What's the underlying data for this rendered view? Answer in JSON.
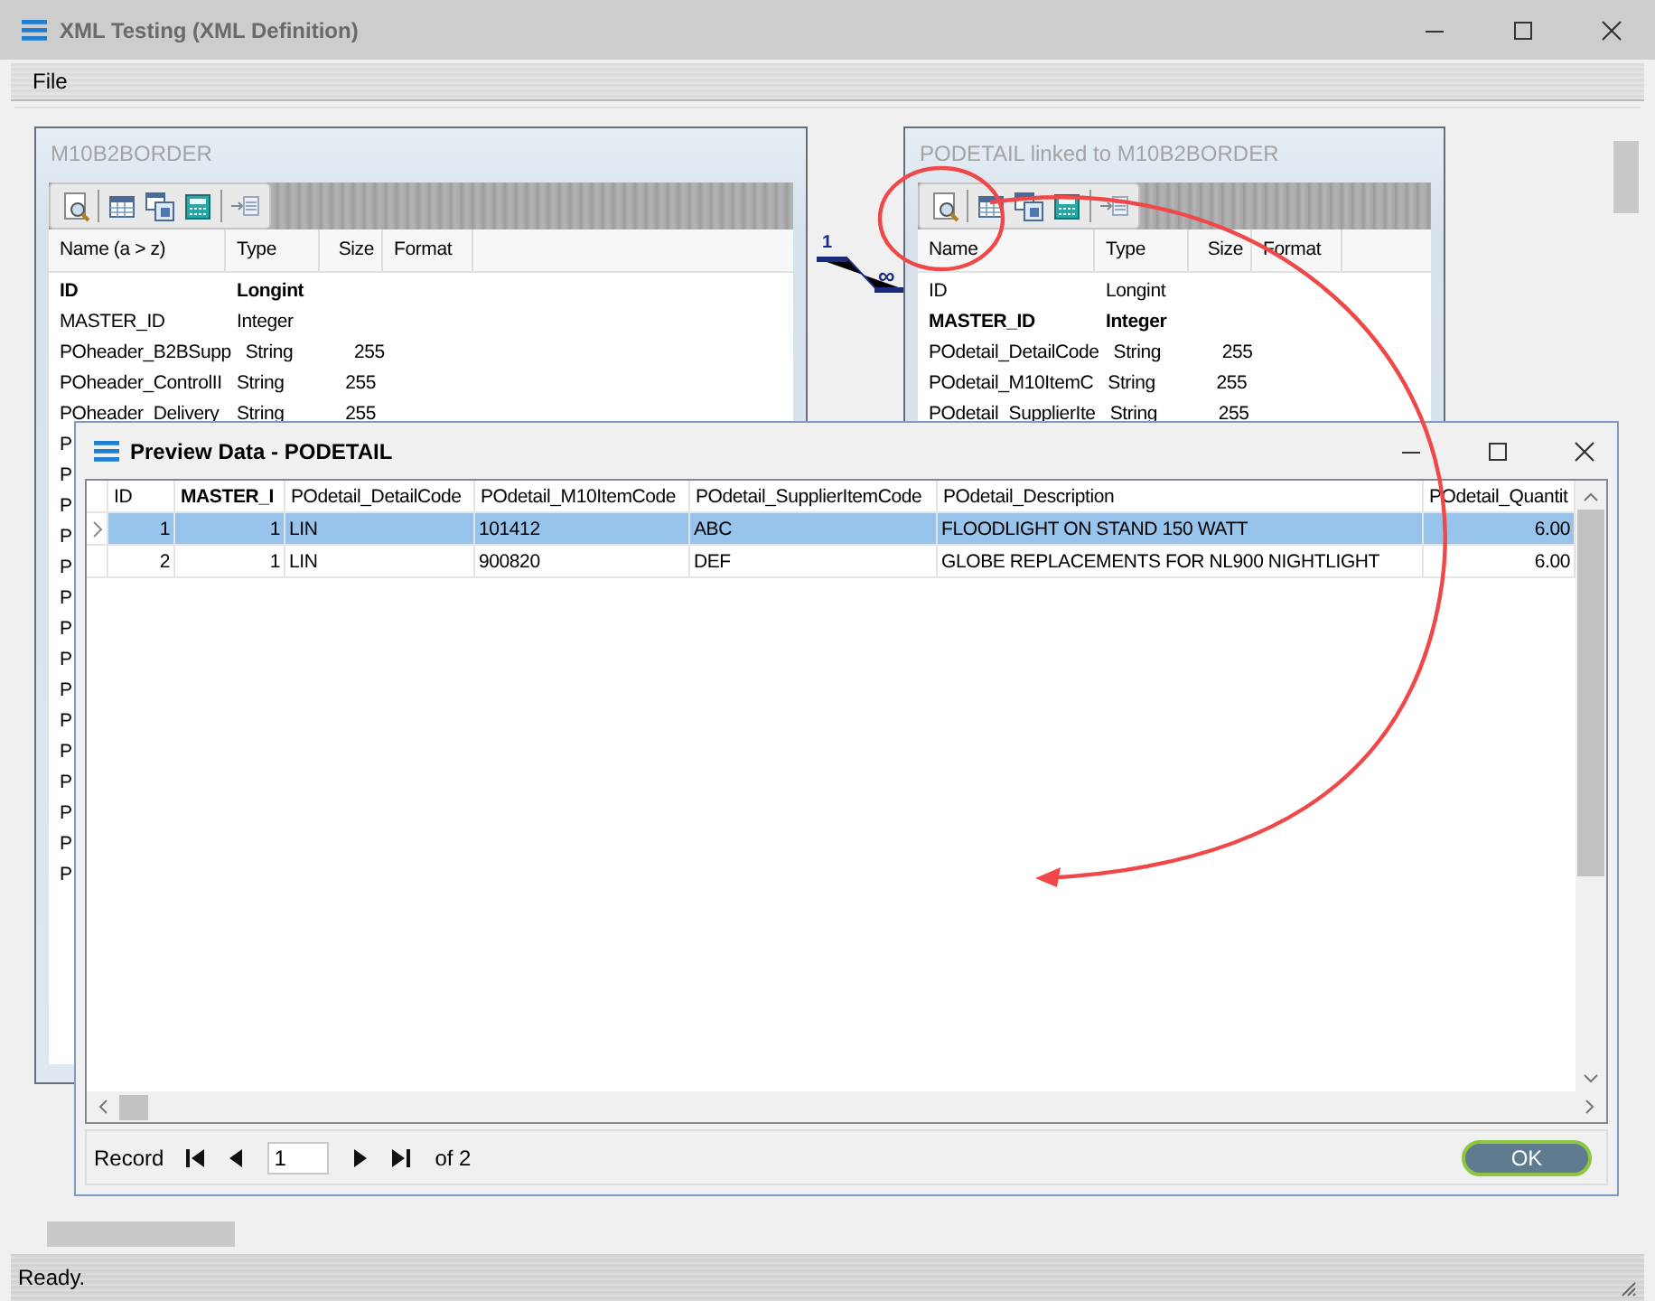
{
  "window": {
    "title": "XML Testing (XML Definition)"
  },
  "menu": [
    "File"
  ],
  "tables": [
    {
      "title": "M10B2BORDER",
      "columns": [
        "Name (a > z)",
        "Type",
        "Size",
        "Format"
      ],
      "fields": [
        {
          "name": "ID",
          "type": "Longint",
          "key": true
        },
        {
          "name": "MASTER_ID",
          "type": "Integer",
          "key": false
        },
        {
          "name": "POheader_B2BSupp",
          "type": "String",
          "size": "255",
          "key": false
        },
        {
          "name": "POheader_ControlII",
          "type": "String",
          "size": "255",
          "key": false
        },
        {
          "name": "POheader_Delivery",
          "type": "String",
          "size": "255",
          "key": false
        },
        {
          "name": "P",
          "key": false
        },
        {
          "name": "P",
          "key": false
        },
        {
          "name": "P",
          "key": false
        },
        {
          "name": "P",
          "key": false
        },
        {
          "name": "P",
          "key": false
        },
        {
          "name": "P",
          "key": false
        },
        {
          "name": "P",
          "key": false
        },
        {
          "name": "P",
          "key": false
        },
        {
          "name": "P",
          "key": false
        },
        {
          "name": "P",
          "key": false
        },
        {
          "name": "P",
          "key": false
        },
        {
          "name": "P",
          "key": false
        },
        {
          "name": "P",
          "key": false
        },
        {
          "name": "P",
          "key": false
        },
        {
          "name": "P",
          "key": false
        }
      ]
    },
    {
      "title": "PODETAIL linked to M10B2BORDER",
      "columns": [
        "Name",
        "Type",
        "Size",
        "Format"
      ],
      "fields": [
        {
          "name": "ID",
          "type": "Longint",
          "key": false
        },
        {
          "name": "MASTER_ID",
          "type": "Integer",
          "key": true
        },
        {
          "name": "POdetail_DetailCode",
          "type": "String",
          "size": "255",
          "key": false
        },
        {
          "name": "POdetail_M10ItemC",
          "type": "String",
          "size": "255",
          "key": false
        },
        {
          "name": "POdetail_SupplierIte",
          "type": "String",
          "size": "255",
          "key": false
        }
      ]
    }
  ],
  "relation": {
    "from_label": "1",
    "to_label": "∞"
  },
  "preview": {
    "title": "Preview Data - PODETAIL",
    "columns": [
      {
        "label": "ID",
        "bold": false,
        "kind": "number"
      },
      {
        "label": "MASTER_I",
        "bold": true,
        "kind": "number"
      },
      {
        "label": "POdetail_DetailCode",
        "bold": false,
        "kind": "text"
      },
      {
        "label": "POdetail_M10ItemCode",
        "bold": false,
        "kind": "text"
      },
      {
        "label": "POdetail_SupplierItemCode",
        "bold": false,
        "kind": "text"
      },
      {
        "label": "POdetail_Description",
        "bold": false,
        "kind": "text"
      },
      {
        "label": "POdetail_Quantit",
        "bold": false,
        "kind": "number"
      }
    ],
    "rows": [
      {
        "selected": true,
        "cells": [
          "1",
          "1",
          "LIN",
          "101412",
          "ABC",
          "FLOODLIGHT ON STAND 150 WATT",
          "6.00"
        ]
      },
      {
        "selected": false,
        "cells": [
          "2",
          "1",
          "LIN",
          "900820",
          "DEF",
          "GLOBE REPLACEMENTS FOR NL900 NIGHTLIGHT",
          "6.00"
        ]
      }
    ],
    "record_label": "Record",
    "record_value": "1",
    "record_total": "of 2",
    "ok": "OK"
  },
  "status_bar": "Ready."
}
